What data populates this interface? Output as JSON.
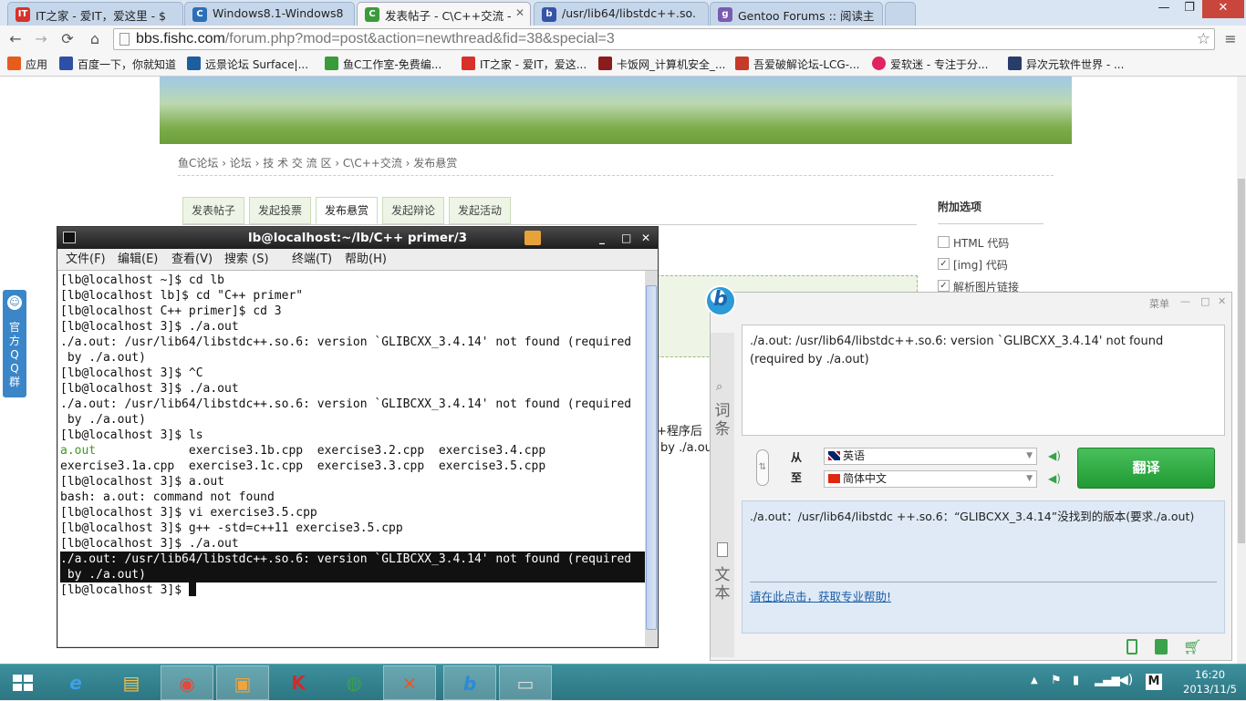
{
  "browser": {
    "tabs": [
      {
        "label": "IT之家 - 爱IT，爱这里 - $",
        "fav": "IT",
        "color": "#d8302a"
      },
      {
        "label": "Windows8.1-Windows8",
        "fav": "C",
        "color": "#2a6fb8"
      },
      {
        "label": "发表帖子 - C\\C++交流 -",
        "fav": "C",
        "color": "#3a9b3a"
      },
      {
        "label": "/usr/lib64/libstdc++.so.",
        "fav": "b",
        "color": "#3553a8"
      },
      {
        "label": "Gentoo Forums :: 阅读主",
        "fav": "g",
        "color": "#7a5bb0"
      }
    ],
    "window_controls": {
      "minimize": "—",
      "restore": "❐",
      "close": "✕"
    },
    "nav": {
      "back": "←",
      "forward": "→",
      "reload": "⟳",
      "home": "⌂",
      "star": "☆",
      "menu": "≡"
    },
    "url_host": "bbs.fishc.com",
    "url_rest": "/forum.php?mod=post&action=newthread&fid=38&special=3",
    "bookmarks": [
      {
        "label": "应用",
        "color": "#e65c1c"
      },
      {
        "label": "百度一下，你就知道",
        "color": "#2d4fa8"
      },
      {
        "label": "远景论坛 Surface|...",
        "color": "#1d5ea0"
      },
      {
        "label": "鱼C工作室-免费编...",
        "color": "#3a9b3a"
      },
      {
        "label": "IT之家 - 爱IT，爱这...",
        "color": "#d8302a"
      },
      {
        "label": "卡饭网_计算机安全_...",
        "color": "#8a1c1c"
      },
      {
        "label": "吾爱破解论坛-LCG-...",
        "color": "#c63a2a"
      },
      {
        "label": "爱软迷 - 专注于分...",
        "color": "#e0245e"
      },
      {
        "label": "异次元软件世界 - ...",
        "color": "#2a3c6a"
      }
    ]
  },
  "forum": {
    "breadcrumb": "鱼C论坛 › 论坛 › 技 术 交 流 区 › C\\C++交流 › 发布悬赏",
    "post_tabs": [
      "发表帖子",
      "发起投票",
      "发布悬赏",
      "发起辩论",
      "发起活动"
    ],
    "side_title": "附加选项",
    "options": [
      {
        "label": "HTML 代码",
        "checked": ""
      },
      {
        "label": "[img] 代码",
        "checked": "✓"
      },
      {
        "label": "解析图片链接",
        "checked": "✓"
      }
    ],
    "partial_text_1": "+程序后",
    "partial_text_2": "by ./a.ou",
    "qq_side": "官方QQ群"
  },
  "terminal": {
    "title": "lb@localhost:~/lb/C++ primer/3",
    "controls": {
      "minimize": "_",
      "maximize": "□",
      "close": "✕"
    },
    "menu": [
      "文件(F)",
      "编辑(E)",
      "查看(V)",
      "搜索 (S)",
      "终端(T)",
      "帮助(H)"
    ],
    "lines": [
      "[lb@localhost ~]$ cd lb",
      "[lb@localhost lb]$ cd \"C++ primer\"",
      "[lb@localhost C++ primer]$ cd 3",
      "[lb@localhost 3]$ ./a.out",
      "./a.out: /usr/lib64/libstdc++.so.6: version `GLIBCXX_3.4.14' not found (required",
      " by ./a.out)",
      "[lb@localhost 3]$ ^C",
      "[lb@localhost 3]$ ./a.out",
      "./a.out: /usr/lib64/libstdc++.so.6: version `GLIBCXX_3.4.14' not found (required",
      " by ./a.out)",
      "[lb@localhost 3]$ ls"
    ],
    "ls_line1_first": "a.out",
    "ls_line1_rest": "             exercise3.1b.cpp  exercise3.2.cpp  exercise3.4.cpp",
    "lines_after": [
      "exercise3.1a.cpp  exercise3.1c.cpp  exercise3.3.cpp  exercise3.5.cpp",
      "[lb@localhost 3]$ a.out",
      "bash: a.out: command not found",
      "[lb@localhost 3]$ vi exercise3.5.cpp",
      "[lb@localhost 3]$ g++ -std=c++11 exercise3.5.cpp",
      "[lb@localhost 3]$ ./a.out"
    ],
    "highlighted": [
      "./a.out: /usr/lib64/libstdc++.so.6: version `GLIBCXX_3.4.14' not found (required",
      " by ./a.out)"
    ],
    "prompt": "[lb@localhost 3]$ "
  },
  "translator": {
    "menu": "菜单",
    "controls": {
      "minimize": "—",
      "maximize": "□",
      "close": "✕"
    },
    "side_dict": "词条",
    "side_text": "文本",
    "source_text": "./a.out: /usr/lib64/libstdc++.so.6: version `GLIBCXX_3.4.14' not found (required by ./a.out)",
    "from_label": "从",
    "to_label": "至",
    "from_lang": "英语",
    "to_lang": "简体中文",
    "translate_button": "翻译",
    "result_text": "./a.out：/usr/lib64/libstdc ++.so.6：“GLIBCXX_3.4.14”没找到的版本(要求./a.out)",
    "help_link": "请在此点击，获取专业帮助!"
  },
  "taskbar": {
    "apps": [
      {
        "name": "ie-icon",
        "glyph": "e",
        "color": "#3ea0e8"
      },
      {
        "name": "file-explorer-icon",
        "glyph": "▤",
        "color": "#f2c14e"
      },
      {
        "name": "chrome-icon",
        "glyph": "◉",
        "color": "#e24a3b"
      },
      {
        "name": "vmware-icon",
        "glyph": "▣",
        "color": "#f2a33a"
      },
      {
        "name": "kaspersky-icon",
        "glyph": "K",
        "color": "#d12a2a"
      },
      {
        "name": "download-manager-icon",
        "glyph": "◍",
        "color": "#3aa24a"
      },
      {
        "name": "crossover-icon",
        "glyph": "✕",
        "color": "#e55a2a"
      },
      {
        "name": "baidu-translate-icon",
        "glyph": "b",
        "color": "#2c8ad6"
      },
      {
        "name": "terminal-icon",
        "glyph": "▭",
        "color": "#ddd"
      }
    ],
    "ime": "M",
    "time": "16:20",
    "date": "2013/11/5"
  }
}
